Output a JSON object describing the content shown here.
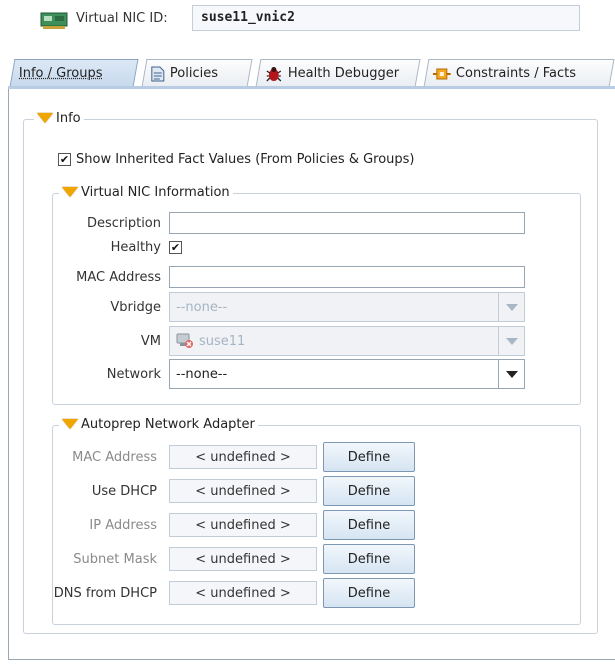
{
  "header": {
    "label": "Virtual NIC ID:",
    "value": "suse11_vnic2"
  },
  "tabs": [
    {
      "label": "Info / Groups",
      "icon": "none",
      "active": true
    },
    {
      "label": "Policies",
      "icon": "document-icon"
    },
    {
      "label": "Health Debugger",
      "icon": "bug-icon"
    },
    {
      "label": "Constraints / Facts",
      "icon": "constraint-icon"
    }
  ],
  "info": {
    "legend": "Info",
    "show_inherited": {
      "label": "Show Inherited Fact Values (From Policies & Groups)",
      "checked": true
    },
    "vnic": {
      "legend": "Virtual NIC Information",
      "description": {
        "label": "Description",
        "value": ""
      },
      "healthy": {
        "label": "Healthy",
        "checked": true
      },
      "mac": {
        "label": "MAC Address",
        "value": ""
      },
      "vbridge": {
        "label": "Vbridge",
        "value": "--none--"
      },
      "vm": {
        "label": "VM",
        "value": "suse11"
      },
      "network": {
        "label": "Network",
        "value": "--none--"
      }
    },
    "autoprep": {
      "legend": "Autoprep Network Adapter",
      "undefined_text": "< undefined >",
      "define_label": "Define",
      "rows": [
        {
          "label": "MAC Address",
          "value": "< undefined >",
          "button": "Define"
        },
        {
          "label": "Use DHCP",
          "value": "< undefined >",
          "button": "Define"
        },
        {
          "label": "IP Address",
          "value": "< undefined >",
          "button": "Define"
        },
        {
          "label": "Subnet Mask",
          "value": "< undefined >",
          "button": "Define"
        },
        {
          "label": "DNS from DHCP",
          "value": "< undefined >",
          "button": "Define"
        }
      ]
    }
  },
  "colors": {
    "accent": "#f0a500",
    "tab_active": "#c7d9ee",
    "border": "#98a6b4"
  }
}
